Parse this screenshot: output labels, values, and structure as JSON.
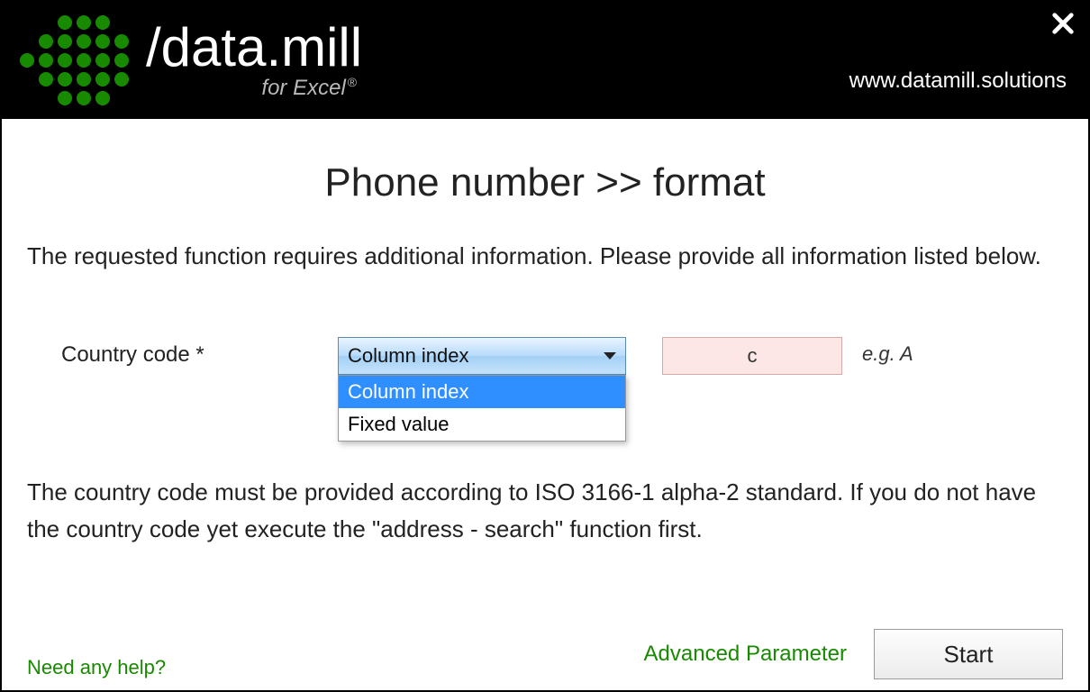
{
  "header": {
    "brand_prefix": "/data.",
    "brand_suffix": "mill",
    "subtitle": "for Excel",
    "registered": "®",
    "url": "www.datamill.solutions"
  },
  "title": "Phone number >> format",
  "intro": "The requested function requires additional information. Please provide all information listed below.",
  "field": {
    "label": "Country code *",
    "select_value": "Column index",
    "options": [
      "Column index",
      "Fixed value"
    ],
    "input_value": "c",
    "hint": "e.g. A"
  },
  "description": "The country code must be provided according to ISO 3166-1 alpha-2 standard. If you do not have the country code yet execute the \"address - search\" function first.",
  "footer": {
    "help": "Need any help?",
    "advanced": "Advanced Parameter",
    "start": "Start"
  }
}
